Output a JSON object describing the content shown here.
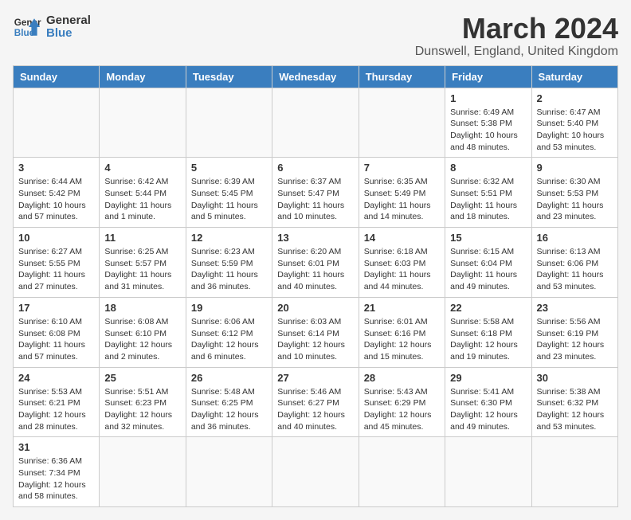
{
  "header": {
    "logo_line1": "General",
    "logo_line2": "Blue",
    "month": "March 2024",
    "location": "Dunswell, England, United Kingdom"
  },
  "days_of_week": [
    "Sunday",
    "Monday",
    "Tuesday",
    "Wednesday",
    "Thursday",
    "Friday",
    "Saturday"
  ],
  "weeks": [
    [
      {
        "day": "",
        "info": ""
      },
      {
        "day": "",
        "info": ""
      },
      {
        "day": "",
        "info": ""
      },
      {
        "day": "",
        "info": ""
      },
      {
        "day": "",
        "info": ""
      },
      {
        "day": "1",
        "info": "Sunrise: 6:49 AM\nSunset: 5:38 PM\nDaylight: 10 hours\nand 48 minutes."
      },
      {
        "day": "2",
        "info": "Sunrise: 6:47 AM\nSunset: 5:40 PM\nDaylight: 10 hours\nand 53 minutes."
      }
    ],
    [
      {
        "day": "3",
        "info": "Sunrise: 6:44 AM\nSunset: 5:42 PM\nDaylight: 10 hours\nand 57 minutes."
      },
      {
        "day": "4",
        "info": "Sunrise: 6:42 AM\nSunset: 5:44 PM\nDaylight: 11 hours\nand 1 minute."
      },
      {
        "day": "5",
        "info": "Sunrise: 6:39 AM\nSunset: 5:45 PM\nDaylight: 11 hours\nand 5 minutes."
      },
      {
        "day": "6",
        "info": "Sunrise: 6:37 AM\nSunset: 5:47 PM\nDaylight: 11 hours\nand 10 minutes."
      },
      {
        "day": "7",
        "info": "Sunrise: 6:35 AM\nSunset: 5:49 PM\nDaylight: 11 hours\nand 14 minutes."
      },
      {
        "day": "8",
        "info": "Sunrise: 6:32 AM\nSunset: 5:51 PM\nDaylight: 11 hours\nand 18 minutes."
      },
      {
        "day": "9",
        "info": "Sunrise: 6:30 AM\nSunset: 5:53 PM\nDaylight: 11 hours\nand 23 minutes."
      }
    ],
    [
      {
        "day": "10",
        "info": "Sunrise: 6:27 AM\nSunset: 5:55 PM\nDaylight: 11 hours\nand 27 minutes."
      },
      {
        "day": "11",
        "info": "Sunrise: 6:25 AM\nSunset: 5:57 PM\nDaylight: 11 hours\nand 31 minutes."
      },
      {
        "day": "12",
        "info": "Sunrise: 6:23 AM\nSunset: 5:59 PM\nDaylight: 11 hours\nand 36 minutes."
      },
      {
        "day": "13",
        "info": "Sunrise: 6:20 AM\nSunset: 6:01 PM\nDaylight: 11 hours\nand 40 minutes."
      },
      {
        "day": "14",
        "info": "Sunrise: 6:18 AM\nSunset: 6:03 PM\nDaylight: 11 hours\nand 44 minutes."
      },
      {
        "day": "15",
        "info": "Sunrise: 6:15 AM\nSunset: 6:04 PM\nDaylight: 11 hours\nand 49 minutes."
      },
      {
        "day": "16",
        "info": "Sunrise: 6:13 AM\nSunset: 6:06 PM\nDaylight: 11 hours\nand 53 minutes."
      }
    ],
    [
      {
        "day": "17",
        "info": "Sunrise: 6:10 AM\nSunset: 6:08 PM\nDaylight: 11 hours\nand 57 minutes."
      },
      {
        "day": "18",
        "info": "Sunrise: 6:08 AM\nSunset: 6:10 PM\nDaylight: 12 hours\nand 2 minutes."
      },
      {
        "day": "19",
        "info": "Sunrise: 6:06 AM\nSunset: 6:12 PM\nDaylight: 12 hours\nand 6 minutes."
      },
      {
        "day": "20",
        "info": "Sunrise: 6:03 AM\nSunset: 6:14 PM\nDaylight: 12 hours\nand 10 minutes."
      },
      {
        "day": "21",
        "info": "Sunrise: 6:01 AM\nSunset: 6:16 PM\nDaylight: 12 hours\nand 15 minutes."
      },
      {
        "day": "22",
        "info": "Sunrise: 5:58 AM\nSunset: 6:18 PM\nDaylight: 12 hours\nand 19 minutes."
      },
      {
        "day": "23",
        "info": "Sunrise: 5:56 AM\nSunset: 6:19 PM\nDaylight: 12 hours\nand 23 minutes."
      }
    ],
    [
      {
        "day": "24",
        "info": "Sunrise: 5:53 AM\nSunset: 6:21 PM\nDaylight: 12 hours\nand 28 minutes."
      },
      {
        "day": "25",
        "info": "Sunrise: 5:51 AM\nSunset: 6:23 PM\nDaylight: 12 hours\nand 32 minutes."
      },
      {
        "day": "26",
        "info": "Sunrise: 5:48 AM\nSunset: 6:25 PM\nDaylight: 12 hours\nand 36 minutes."
      },
      {
        "day": "27",
        "info": "Sunrise: 5:46 AM\nSunset: 6:27 PM\nDaylight: 12 hours\nand 40 minutes."
      },
      {
        "day": "28",
        "info": "Sunrise: 5:43 AM\nSunset: 6:29 PM\nDaylight: 12 hours\nand 45 minutes."
      },
      {
        "day": "29",
        "info": "Sunrise: 5:41 AM\nSunset: 6:30 PM\nDaylight: 12 hours\nand 49 minutes."
      },
      {
        "day": "30",
        "info": "Sunrise: 5:38 AM\nSunset: 6:32 PM\nDaylight: 12 hours\nand 53 minutes."
      }
    ],
    [
      {
        "day": "31",
        "info": "Sunrise: 6:36 AM\nSunset: 7:34 PM\nDaylight: 12 hours\nand 58 minutes."
      },
      {
        "day": "",
        "info": ""
      },
      {
        "day": "",
        "info": ""
      },
      {
        "day": "",
        "info": ""
      },
      {
        "day": "",
        "info": ""
      },
      {
        "day": "",
        "info": ""
      },
      {
        "day": "",
        "info": ""
      }
    ]
  ]
}
